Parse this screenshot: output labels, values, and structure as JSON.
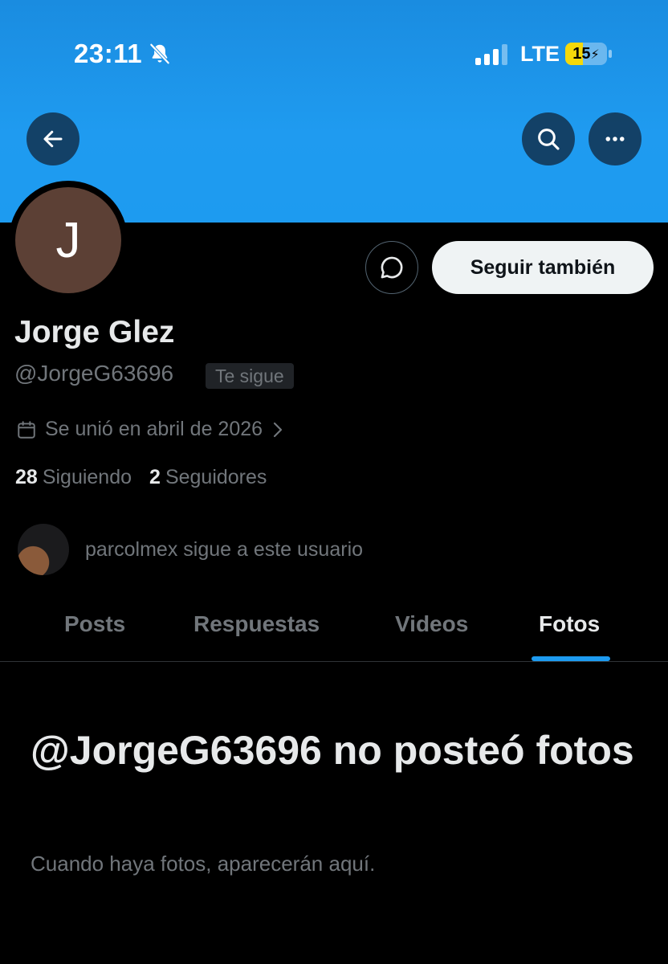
{
  "status_bar": {
    "time": "23:11",
    "network": "LTE",
    "battery_level": "15",
    "battery_fraction": 0.15,
    "signal_bars_active": 3
  },
  "nav": {
    "back_icon": "arrow-left-icon",
    "search_icon": "search-icon",
    "more_icon": "more-horizontal-icon"
  },
  "profile": {
    "avatar_initial": "J",
    "avatar_color": "#5c4035",
    "name": "Jorge Glez",
    "handle": "@JorgeG63696",
    "follows_you_badge": "Te sigue",
    "joined": "Se unió en abril de 2026",
    "following_count": "28",
    "following_label": "Siguiendo",
    "followers_count": "2",
    "followers_label": "Seguidores",
    "followed_by_text": "parcolmex sigue a este usuario"
  },
  "actions": {
    "message_icon": "message-icon",
    "follow_label": "Seguir también"
  },
  "tabs": [
    {
      "label": "Posts",
      "active": false
    },
    {
      "label": "Respuestas",
      "active": false
    },
    {
      "label": "Videos",
      "active": false
    },
    {
      "label": "Fotos",
      "active": true
    }
  ],
  "empty_state": {
    "title": "@JorgeG63696 no posteó fotos",
    "subtitle": "Cuando haya fotos, aparecerán aquí."
  },
  "colors": {
    "accent": "#1d9bf0",
    "background": "#000000",
    "text_primary": "#e7e9ea",
    "text_secondary": "#71767b",
    "battery_fill": "#f5d90a"
  }
}
